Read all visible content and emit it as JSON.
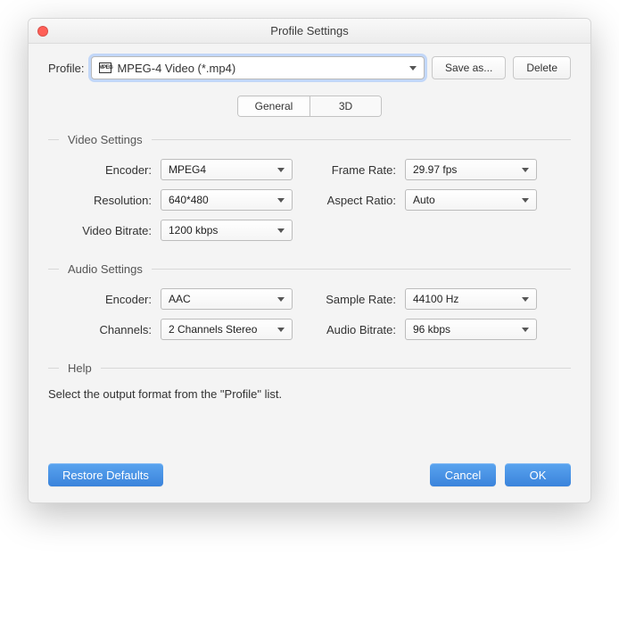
{
  "window": {
    "title": "Profile Settings"
  },
  "profile": {
    "label": "Profile:",
    "value": "MPEG-4 Video (*.mp4)",
    "iconText": "MPEG"
  },
  "buttons": {
    "saveAs": "Save as...",
    "delete": "Delete",
    "restore": "Restore Defaults",
    "cancel": "Cancel",
    "ok": "OK"
  },
  "tabs": {
    "general": "General",
    "threeD": "3D"
  },
  "video": {
    "heading": "Video Settings",
    "encoderLabel": "Encoder:",
    "encoderValue": "MPEG4",
    "resolutionLabel": "Resolution:",
    "resolutionValue": "640*480",
    "bitrateLabel": "Video Bitrate:",
    "bitrateValue": "1200 kbps",
    "frameRateLabel": "Frame Rate:",
    "frameRateValue": "29.97 fps",
    "aspectLabel": "Aspect Ratio:",
    "aspectValue": "Auto"
  },
  "audio": {
    "heading": "Audio Settings",
    "encoderLabel": "Encoder:",
    "encoderValue": "AAC",
    "channelsLabel": "Channels:",
    "channelsValue": "2 Channels Stereo",
    "sampleRateLabel": "Sample Rate:",
    "sampleRateValue": "44100 Hz",
    "bitrateLabel": "Audio Bitrate:",
    "bitrateValue": "96 kbps"
  },
  "help": {
    "heading": "Help",
    "text": "Select the output format from the \"Profile\" list."
  }
}
